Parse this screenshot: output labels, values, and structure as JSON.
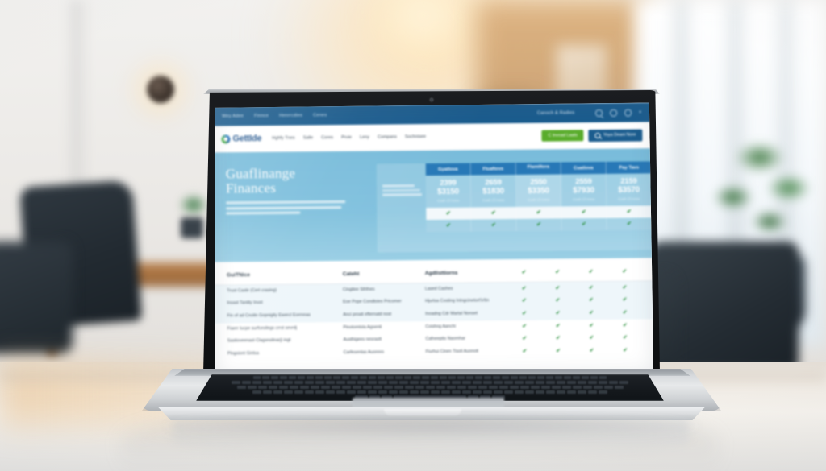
{
  "scene": {
    "description": "Blurred modern office interior with laptop on light wooden desk",
    "background_elements": [
      "white-wall",
      "wall-lamp",
      "wooden-cabinet",
      "bright-windows",
      "potted-plant",
      "office-chairs",
      "wooden-table"
    ]
  },
  "device": {
    "type": "laptop",
    "chassis_color": "#cfd3d6",
    "bezel_color": "#141619",
    "webcam": "webcam-dot"
  },
  "site": {
    "topbar": {
      "links": [
        "Wey Adee",
        "Finnce",
        "Henrrcdies",
        "Cenes"
      ],
      "center_text": "Canoch & Radies",
      "icons": [
        "search-icon",
        "globe-icon",
        "account-icon"
      ],
      "caret": "▾",
      "bg": "#1d5c8c"
    },
    "header": {
      "logo_text": "GettIde",
      "logo_mark": "swirl-logo-icon",
      "nav": [
        "Hghfy Tnes",
        "Salle",
        "Cores",
        "Prvie",
        "Leny",
        "Compans",
        "Sochnisee"
      ],
      "cta_primary": {
        "label": "C Invoad Laats",
        "color": "#5bab2f"
      },
      "cta_secondary": {
        "label": "Yoya Deani Nore",
        "color": "#1d5c8c",
        "icon": "magnifier-icon"
      }
    },
    "hero": {
      "title_line1": "Guaflinange",
      "title_line2": "Finances",
      "bg": "#7bbcd9"
    },
    "pricing": {
      "desc_lines": [
        "Cond Nod",
        "Hod Nacromod",
        "Unticarlvig Kirup"
      ],
      "note": "Cosh Cf Anno",
      "columns": [
        {
          "name": "Gyatlova",
          "number": "2399",
          "price": "$3150",
          "featured": false
        },
        {
          "name": "Fluaftovs",
          "number": "2659",
          "price": "$1830",
          "featured": false
        },
        {
          "name": "Flamillora",
          "number": "2550",
          "price": "$3350",
          "featured": true
        },
        {
          "name": "Cuatlova",
          "number": "2559",
          "price": "$7930",
          "featured": false
        },
        {
          "name": "Pay Tavs",
          "number": "2159",
          "price": "$3570",
          "featured": false
        }
      ],
      "check_glyph": "✔",
      "check_color": "#2f8f3f"
    },
    "compare": {
      "headers": [
        "GuiTNice",
        "Cateht",
        "Agdlisttiorns"
      ],
      "header_checks": [
        "✔",
        "✔",
        "✔",
        "✔"
      ],
      "rows": [
        {
          "c1": "Trust Castir (Cert crasing)",
          "c2": "Cingitee Sthfnes",
          "c3": "Lased Cashes",
          "checks": [
            "✔",
            "✔",
            "✔",
            "✔"
          ]
        },
        {
          "c1": "Insast Tantity Invst",
          "c2": "Eoe Pope Condtoies Pricomer",
          "c3": "Hjurtsa Costing Intngcinetort'ir/tin",
          "checks": [
            "✔",
            "✔",
            "✔",
            "✔"
          ]
        },
        {
          "c1": "Fin of ad Cnoitn Gopnigity Ewercl Eorrnnas",
          "c2": "Anci proati efternatd nost",
          "c3": "Inoadng Cdr Martal Nonset",
          "checks": [
            "✔",
            "✔",
            "✔",
            "✔"
          ]
        },
        {
          "c1": "Fiaerr lucpe surfcesilegs crrst sevrdj",
          "c2": "Pinotomtsta Agsenti",
          "c3": "Coishng Aanchi",
          "checks": [
            "✔",
            "✔",
            "✔",
            "✔"
          ]
        },
        {
          "c1": "Sastioveenast Clagsnsitnarj) ingt",
          "c2": "Austhigees nesrastt",
          "c3": "Cafneeptis Naomhar",
          "checks": [
            "✔",
            "✔",
            "✔",
            "✔"
          ]
        },
        {
          "c1": "Pingsiont Ginlsa",
          "c2": "Carfesentas Auonnrs",
          "c3": "Fiurhui Cinen Tisoli Auonoit",
          "checks": [
            "✔",
            "✔",
            "✔",
            "✔"
          ]
        }
      ]
    }
  }
}
